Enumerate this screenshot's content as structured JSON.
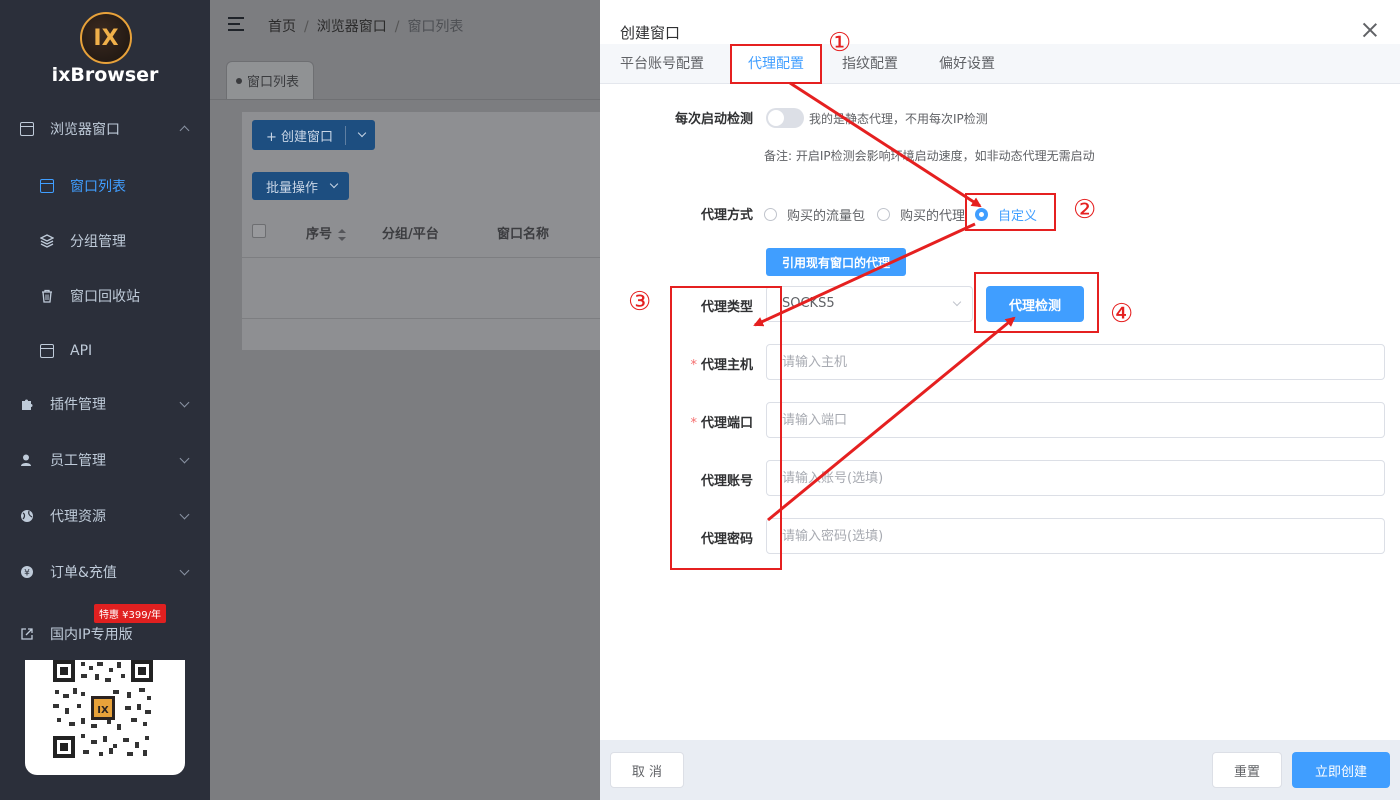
{
  "app": {
    "name": "ixBrowser",
    "logo_text": "IX"
  },
  "sidebar": {
    "items": [
      {
        "label": "浏览器窗口",
        "icon": "window-icon",
        "expanded": true
      },
      {
        "label": "窗口列表",
        "icon": "window-list-icon",
        "active": true
      },
      {
        "label": "分组管理",
        "icon": "layers-icon"
      },
      {
        "label": "窗口回收站",
        "icon": "trash-icon"
      },
      {
        "label": "API",
        "icon": "api-icon"
      },
      {
        "label": "插件管理",
        "icon": "puzzle-icon"
      },
      {
        "label": "员工管理",
        "icon": "users-icon"
      },
      {
        "label": "代理资源",
        "icon": "globe-icon"
      },
      {
        "label": "订单&充值",
        "icon": "coin-icon"
      },
      {
        "label": "国内IP专用版",
        "icon": "external-link-icon"
      }
    ],
    "promo_badge": "特惠 ¥399/年"
  },
  "header": {
    "breadcrumb": [
      "首页",
      "浏览器窗口",
      "窗口列表"
    ],
    "breadcrumb_sep": "/"
  },
  "tabs": {
    "active_tab": "窗口列表"
  },
  "main": {
    "create_button": "+ 创建窗口",
    "batch_button": "批量操作",
    "table_headers": [
      "序号",
      "分组/平台",
      "窗口名称"
    ]
  },
  "drawer": {
    "title": "创建窗口",
    "tabs": [
      "平台账号配置",
      "代理配置",
      "指纹配置",
      "偏好设置"
    ],
    "active_tab_index": 1,
    "form": {
      "startup_check_label": "每次启动检测",
      "startup_check_hint": "我的是静态代理，不用每次IP检测",
      "startup_check_on": false,
      "note": "备注: 开启IP检测会影响环境启动速度，如非动态代理无需启动",
      "proxy_mode_label": "代理方式",
      "proxy_mode_options": [
        "购买的流量包",
        "购买的代理",
        "自定义"
      ],
      "proxy_mode_selected": "自定义",
      "ref_button": "引用现有窗口的代理",
      "proxy_type_label": "代理类型",
      "proxy_type_value": "SOCKS5",
      "check_button": "代理检测",
      "host_label": "代理主机",
      "host_placeholder": "请输入主机",
      "port_label": "代理端口",
      "port_placeholder": "请输入端口",
      "account_label": "代理账号",
      "account_placeholder": "请输入账号(选填)",
      "password_label": "代理密码",
      "password_placeholder": "请输入密码(选填)",
      "required_mark": "*"
    },
    "footer": {
      "cancel": "取 消",
      "reset": "重置",
      "create": "立即创建"
    }
  },
  "annotations": {
    "labels": [
      "①",
      "②",
      "③",
      "④"
    ],
    "color": "#e52020"
  },
  "colors": {
    "primary": "#409eff",
    "sidebar_bg": "#2b2f3a",
    "annotation": "#e52020"
  }
}
